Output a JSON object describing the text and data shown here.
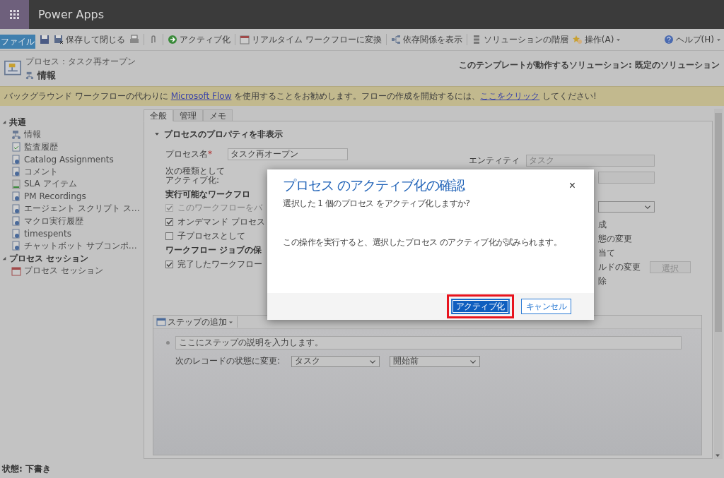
{
  "app_bar": {
    "title": "Power Apps"
  },
  "command_bar": {
    "file_tab": "ファイル",
    "save_and_close": "保存して閉じる",
    "activate": "アクティブ化",
    "convert": "リアルタイム ワークフローに変換",
    "dependencies": "依存関係を表示",
    "solution_layers": "ソリューションの階層",
    "actions": "操作(A)",
    "help": "ヘルプ(H)"
  },
  "header": {
    "breadcrumb": "プロセス：タスク再オープン",
    "title": "情報",
    "solution_text": "このテンプレートが動作するソリューション: 既定のソリューション"
  },
  "notice": {
    "text_before": "バックグラウンド ワークフローの代わりに ",
    "link1": "Microsoft Flow",
    "text_middle": " を使用することをお勧めします。フローの作成を開始するには、",
    "link2": "ここをクリック",
    "text_after": " してください!"
  },
  "nav": [
    {
      "label": "共通",
      "expanded": true,
      "items": [
        {
          "label": "情報"
        },
        {
          "label": "監査履歴"
        },
        {
          "label": "Catalog Assignments"
        },
        {
          "label": "コメント"
        },
        {
          "label": "SLA アイテム"
        },
        {
          "label": "PM Recordings"
        },
        {
          "label": "エージェント スクリプト ス…"
        },
        {
          "label": "マクロ実行履歴"
        },
        {
          "label": "timespents"
        },
        {
          "label": "チャットボット サブコンポ…"
        }
      ]
    },
    {
      "label": "プロセス セッション",
      "expanded": true,
      "items": [
        {
          "label": "プロセス セッション"
        }
      ]
    }
  ],
  "tabs": [
    {
      "label": "全般",
      "selected": true
    },
    {
      "label": "管理",
      "selected": false
    },
    {
      "label": "メモ",
      "selected": false
    }
  ],
  "section": {
    "label": "プロセスのプロパティを非表示",
    "expanded": true
  },
  "form": {
    "process_name": {
      "label": "プロセス名",
      "required_mark": "*",
      "value": "タスク再オープン"
    },
    "activate_as": {
      "label": "次の種類としてアクティブ化:"
    },
    "available_header": "実行可能なワークフロ",
    "available_options": [
      {
        "label": "このワークフローをバ",
        "checked": true,
        "disabled": true
      },
      {
        "label": "オンデマンド プロセス",
        "checked": true,
        "disabled": false
      },
      {
        "label": "子プロセスとして",
        "checked": false,
        "disabled": false
      }
    ],
    "retention_header": "ワークフロー ジョブの保",
    "retention_options": [
      {
        "label": "完了したワークフロー",
        "checked": true,
        "disabled": false
      }
    ],
    "entity": {
      "label": "エンティティ",
      "value": "タスク",
      "disabled": true
    },
    "right_fragments": [
      {
        "label": "成"
      },
      {
        "label": "態の変更"
      },
      {
        "label": "当て"
      },
      {
        "label": "ルドの変更",
        "button": "選択"
      },
      {
        "label": "除"
      }
    ]
  },
  "steps": {
    "add_step": "ステップの追加",
    "description": "ここにステップの説明を入力します。",
    "status_label": "次のレコードの状態に変更:",
    "entity_select": "タスク",
    "status_select": "開始前"
  },
  "dialog": {
    "title": "プロセス のアクティブ化の確認",
    "close": "×",
    "question": "選択した 1 個のプロセス をアクティブ化しますか?",
    "message": "この操作を実行すると、選択したプロセス のアクティブ化が試みられます。",
    "buttons": [
      {
        "label": "アクティブ化",
        "kind": "primary",
        "highlighted": true
      },
      {
        "label": "キャンセル",
        "kind": "secondary",
        "highlighted": false
      }
    ]
  },
  "status_bar": {
    "label": "状態:",
    "value": "下書き"
  }
}
